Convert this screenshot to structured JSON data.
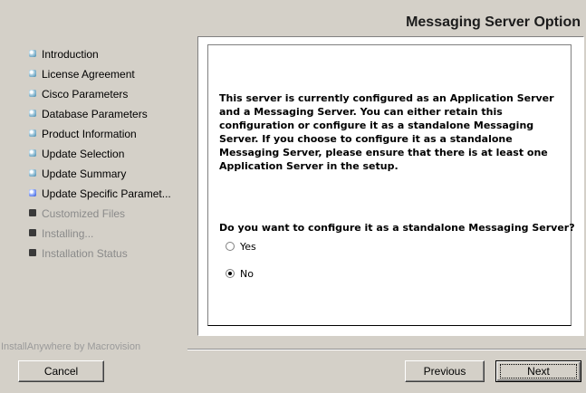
{
  "header": {
    "title": "Messaging Server Option"
  },
  "steps": [
    {
      "label": "Introduction",
      "state": "done"
    },
    {
      "label": "License Agreement",
      "state": "done"
    },
    {
      "label": "Cisco Parameters",
      "state": "done"
    },
    {
      "label": "Database Parameters",
      "state": "done"
    },
    {
      "label": "Product Information",
      "state": "done"
    },
    {
      "label": "Update Selection",
      "state": "done"
    },
    {
      "label": "Update Summary",
      "state": "done"
    },
    {
      "label": "Update Specific Paramet...",
      "state": "current"
    },
    {
      "label": "Customized Files",
      "state": "pending"
    },
    {
      "label": "Installing...",
      "state": "pending"
    },
    {
      "label": "Installation Status",
      "state": "pending"
    }
  ],
  "content": {
    "description": "This server is currently configured as an Application Server\nand a Messaging Server. You can either retain this\nconfiguration or configure it as a standalone Messaging\nServer. If you choose to configure it as a standalone\nMessaging Server, please ensure that there is at least one\nApplication Server in the setup.",
    "question": "Do you want to configure it as a standalone Messaging Server?",
    "options": [
      {
        "label": "Yes",
        "selected": false
      },
      {
        "label": "No",
        "selected": true
      }
    ]
  },
  "footer": {
    "brand": "InstallAnywhere by Macrovision",
    "cancel_label": "Cancel",
    "previous_label": "Previous",
    "next_label": "Next"
  }
}
